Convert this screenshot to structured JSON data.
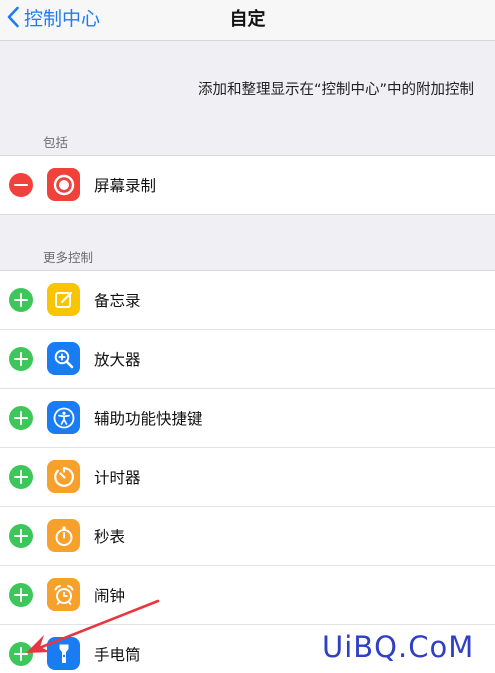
{
  "navbar": {
    "back_label": "控制中心",
    "title": "自定"
  },
  "description": "添加和整理显示在“控制中心”中的附加控制",
  "sections": {
    "included": {
      "header": "包括",
      "items": [
        {
          "label": "屏幕录制",
          "icon": "record-icon",
          "color": "#f0413a"
        }
      ]
    },
    "more": {
      "header": "更多控制",
      "items": [
        {
          "label": "备忘录",
          "icon": "notes-icon",
          "color": "#f9c500"
        },
        {
          "label": "放大器",
          "icon": "magnifier-icon",
          "color": "#1a7cf3"
        },
        {
          "label": "辅助功能快捷键",
          "icon": "accessibility-icon",
          "color": "#1a7cf3"
        },
        {
          "label": "计时器",
          "icon": "timer-icon",
          "color": "#f7a02b"
        },
        {
          "label": "秒表",
          "icon": "stopwatch-icon",
          "color": "#f7a02b"
        },
        {
          "label": "闹钟",
          "icon": "alarm-icon",
          "color": "#f7a02b"
        },
        {
          "label": "手电筒",
          "icon": "flashlight-icon",
          "color": "#1a7cf3"
        }
      ]
    }
  },
  "watermark": "UiBQ.CoM",
  "colors": {
    "accent": "#1f7cf5",
    "remove": "#f0413a",
    "add": "#3dc75a",
    "arrow": "#e8353f"
  }
}
